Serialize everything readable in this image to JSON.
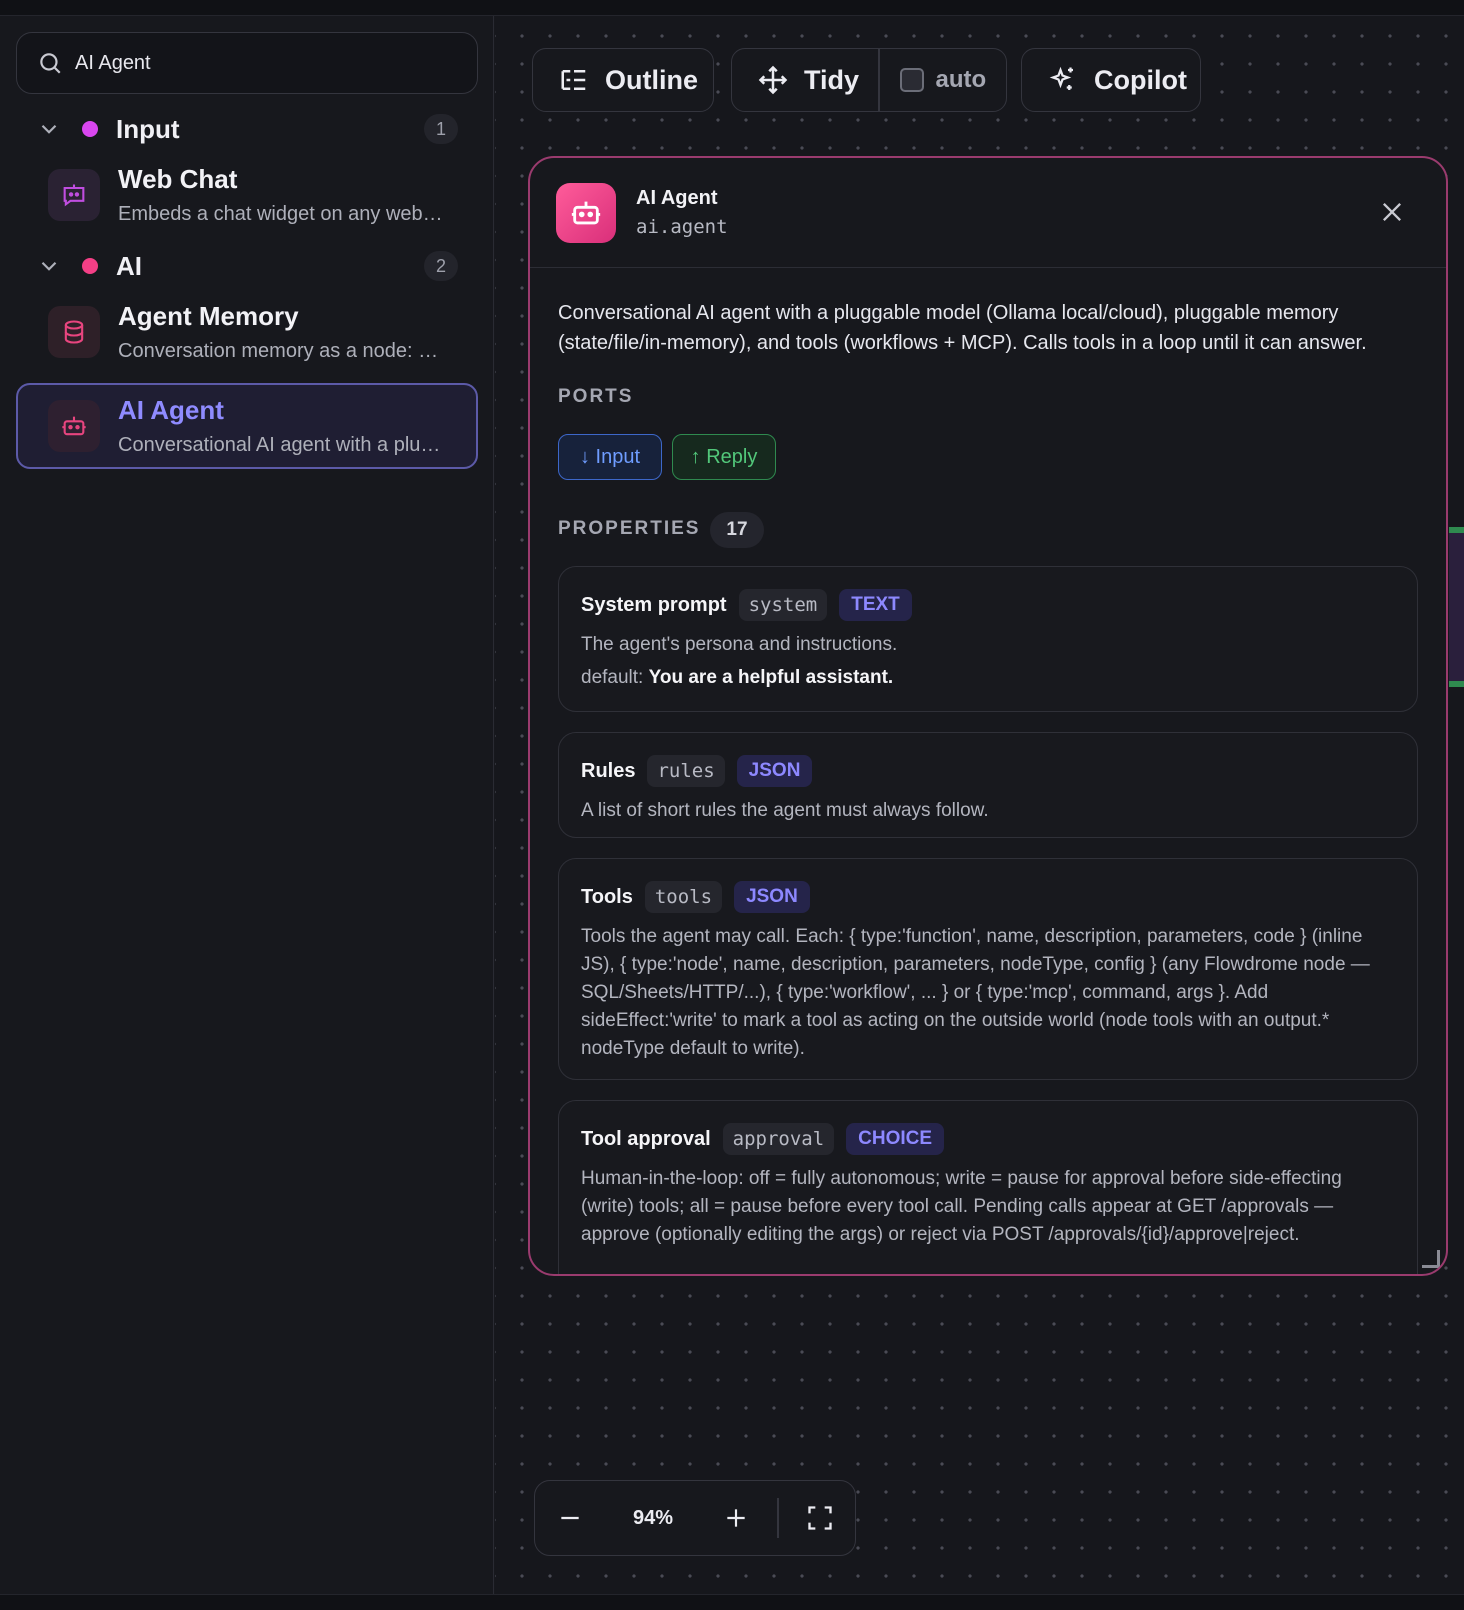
{
  "search": {
    "value": "AI Agent"
  },
  "groups": [
    {
      "name": "Input",
      "count": "1",
      "dot_color": "#d946ef",
      "items": [
        {
          "title": "Web Chat",
          "subtitle": "Embeds a chat widget on any websit...",
          "icon": "chat-bot-icon"
        }
      ]
    },
    {
      "name": "AI",
      "count": "2",
      "dot_color": "#f43f86",
      "items": [
        {
          "title": "Agent Memory",
          "subtitle": "Conversation memory as a node: ch...",
          "icon": "database-icon"
        },
        {
          "title": "AI Agent",
          "subtitle": "Conversational AI agent with a plug...",
          "icon": "robot-icon",
          "selected": true
        }
      ]
    }
  ],
  "toolbar": {
    "outline": "Outline",
    "tidy": "Tidy",
    "auto": "auto",
    "copilot": "Copilot"
  },
  "panel": {
    "title": "AI Agent",
    "type": "ai.agent",
    "description": "Conversational AI agent with a pluggable model (Ollama local/cloud), pluggable memory (state/file/in-memory), and tools (workflows + MCP). Calls tools in a loop until it can answer.",
    "ports_label": "PORTS",
    "ports": {
      "input": "↓ Input",
      "output": "↑ Reply"
    },
    "properties_label": "PROPERTIES",
    "properties_count": "17",
    "properties": [
      {
        "name": "System prompt",
        "key": "system",
        "type": "TEXT",
        "description": "The agent's persona and instructions.",
        "default_label": "default:",
        "default_value": "You are a helpful assistant."
      },
      {
        "name": "Rules",
        "key": "rules",
        "type": "JSON",
        "description": "A list of short rules the agent must always follow."
      },
      {
        "name": "Tools",
        "key": "tools",
        "type": "JSON",
        "description": "Tools the agent may call. Each: { type:'function', name, description, parameters, code } (inline JS), { type:'node', name, description, parameters, nodeType, config } (any Flowdrome node — SQL/Sheets/HTTP/...), { type:'workflow', ... } or { type:'mcp', command, args }. Add sideEffect:'write' to mark a tool as acting on the outside world (node tools with an output.* nodeType default to write)."
      },
      {
        "name": "Tool approval",
        "key": "approval",
        "type": "CHOICE",
        "description": "Human-in-the-loop: off = fully autonomous; write = pause for approval before side-effecting (write) tools; all = pause before every tool call. Pending calls appear at GET /approvals — approve (optionally editing the args) or reject via POST /approvals/{id}/approve|reject."
      }
    ]
  },
  "zoom": {
    "level": "94%"
  },
  "colors": {
    "accent": "#8f8bff",
    "panel_border": "#9a3b6e",
    "agent_icon": "#ff5c9a"
  }
}
